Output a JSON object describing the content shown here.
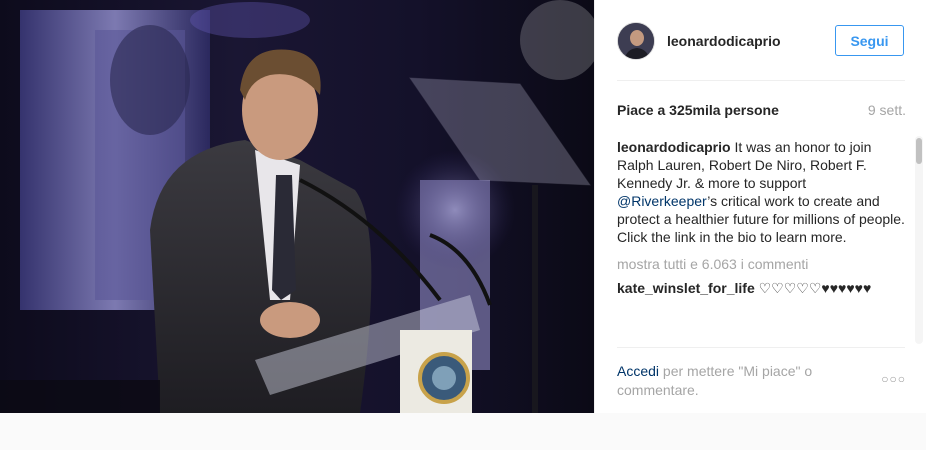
{
  "post": {
    "username": "leonardodicaprio",
    "follow_label": "Segui",
    "likes_text": "Piace a 325mila persone",
    "time_ago": "9 sett.",
    "caption_user": "leonardodicaprio",
    "caption_before": " It was an honor to join Ralph Lauren, Robert De Niro, Robert F. Kennedy Jr. & more to support ",
    "caption_mention": "@Riverkeeper",
    "caption_after": "’s critical work to create and protect a healthier future for millions of people. Click the link in the bio to learn more.",
    "show_all_comments": "mostra tutti e 6.063 i commenti",
    "comments": [
      {
        "user": "kate_winslet_for_life",
        "text": " ♡♡♡♡♡♥♥♥♥♥♥"
      }
    ],
    "login_link": "Accedi",
    "login_rest": " per mettere \"Mi piace\" o commentare.",
    "more_icon": "ellipsis-icon"
  },
  "colors": {
    "accent": "#3897f0",
    "link": "#003569",
    "muted": "#a5a5a5",
    "text": "#262626"
  }
}
